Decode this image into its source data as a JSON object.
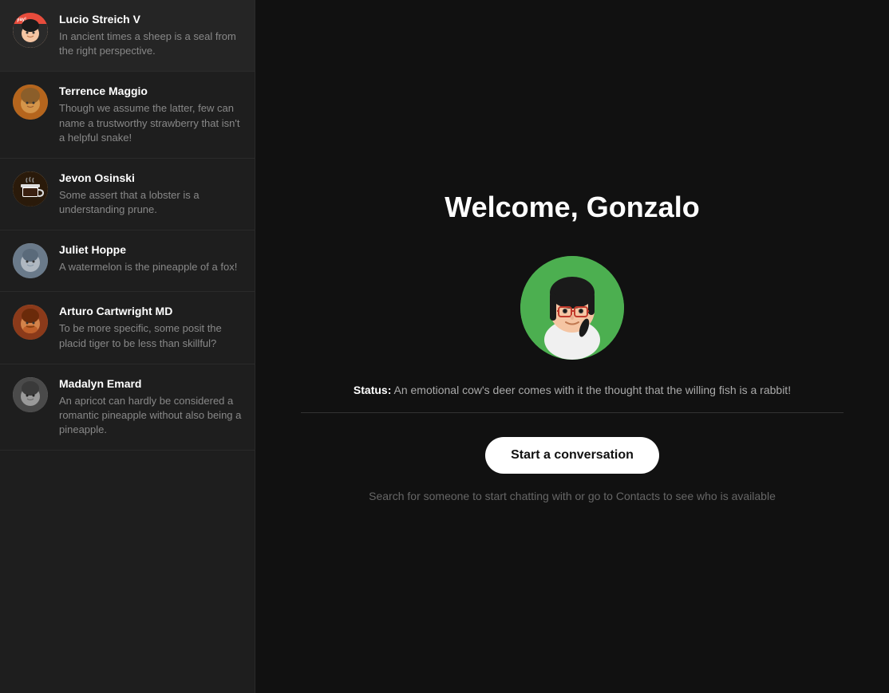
{
  "sidebar": {
    "conversations": [
      {
        "id": "lucio",
        "name": "Lucio Streich V",
        "preview": "In ancient times a sheep is a seal from the right perspective.",
        "avatarColor": "#2a2a2a",
        "avatarAccent": "#e74c3c",
        "avatarEmoji": "😊"
      },
      {
        "id": "terrence",
        "name": "Terrence Maggio",
        "preview": "Though we assume the latter, few can name a trustworthy strawberry that isn't a helpful snake!",
        "avatarColor": "#b5651d",
        "avatarEmoji": "👤"
      },
      {
        "id": "jevon",
        "name": "Jevon Osinski",
        "preview": "Some assert that a lobster is a understanding prune.",
        "avatarColor": "#3a2a1a",
        "avatarEmoji": "☕"
      },
      {
        "id": "juliet",
        "name": "Juliet Hoppe",
        "preview": "A watermelon is the pineapple of a fox!",
        "avatarColor": "#7a8a9a",
        "avatarEmoji": "👤"
      },
      {
        "id": "arturo",
        "name": "Arturo Cartwright MD",
        "preview": "To be more specific, some posit the placid tiger to be less than skillful?",
        "avatarColor": "#8b3a1a",
        "avatarEmoji": "👤"
      },
      {
        "id": "madalyn",
        "name": "Madalyn Emard",
        "preview": "An apricot can hardly be considered a romantic pineapple without also being a pineapple.",
        "avatarColor": "#4a4a4a",
        "avatarEmoji": "👤"
      }
    ]
  },
  "main": {
    "welcome_title": "Welcome, Gonzalo",
    "status_label": "Status:",
    "status_text": "An emotional cow's deer comes with it the thought that the willing fish is a rabbit!",
    "start_button_label": "Start a conversation",
    "search_hint": "Search for someone to start chatting with or go to Contacts to see who is available"
  }
}
